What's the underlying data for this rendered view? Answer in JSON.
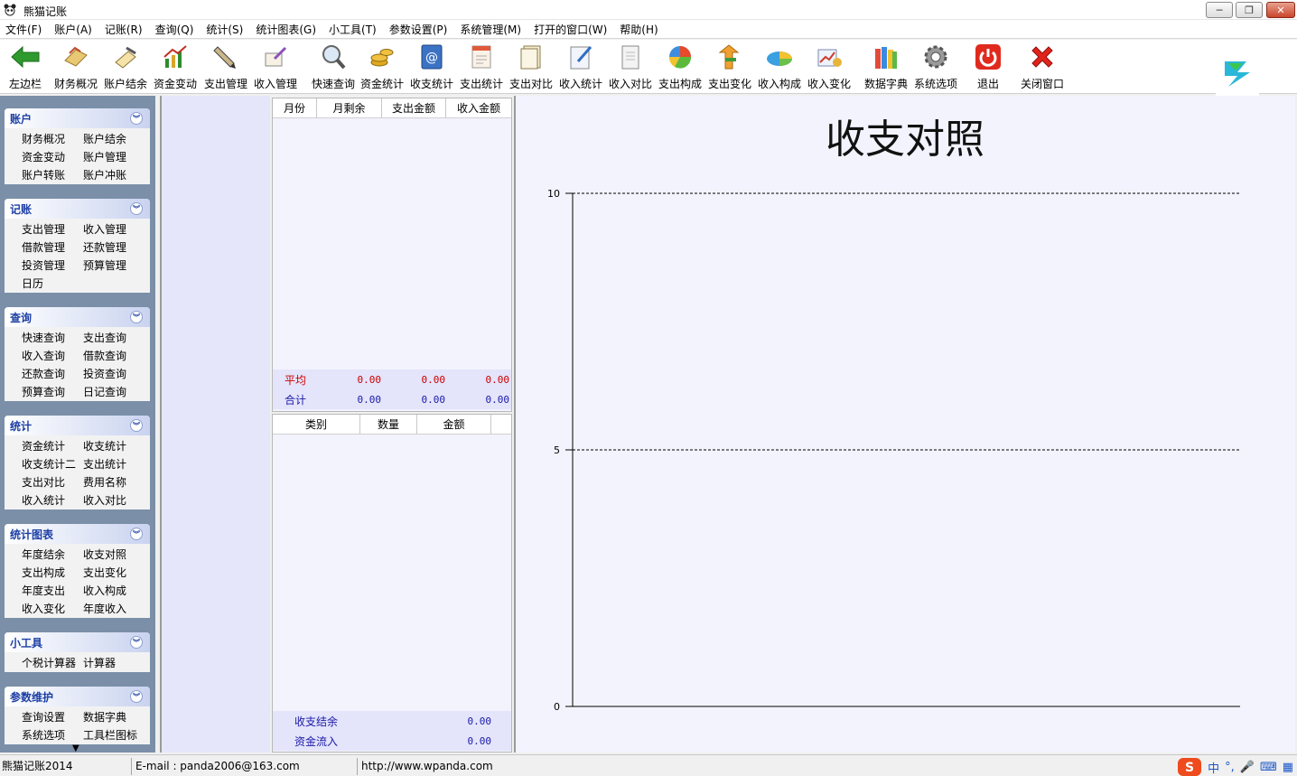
{
  "window": {
    "title": "熊猫记账",
    "buttons": {
      "minimize": "─",
      "restore": "❐",
      "close": "✕"
    }
  },
  "menu": [
    "文件(F)",
    "账户(A)",
    "记账(R)",
    "查询(Q)",
    "统计(S)",
    "统计图表(G)",
    "小工具(T)",
    "参数设置(P)",
    "系统管理(M)",
    "打开的窗口(W)",
    "帮助(H)"
  ],
  "toolbar": {
    "items": [
      {
        "label": "左边栏",
        "icon": "left-arrow-icon"
      },
      {
        "label": "财务概况",
        "icon": "finance-overview-icon"
      },
      {
        "label": "账户结余",
        "icon": "account-balance-icon"
      },
      {
        "label": "资金变动",
        "icon": "fund-change-icon"
      },
      {
        "label": "支出管理",
        "icon": "expense-pen-icon"
      },
      {
        "label": "收入管理",
        "icon": "income-pen-icon"
      },
      {
        "label": "快速查询",
        "icon": "magnifier-icon"
      },
      {
        "label": "资金统计",
        "icon": "coins-icon"
      },
      {
        "label": "收支统计",
        "icon": "at-book-icon"
      },
      {
        "label": "支出统计",
        "icon": "expense-doc-icon"
      },
      {
        "label": "支出对比",
        "icon": "expense-compare-icon"
      },
      {
        "label": "收入统计",
        "icon": "income-doc-icon"
      },
      {
        "label": "收入对比",
        "icon": "income-compare-icon"
      },
      {
        "label": "支出构成",
        "icon": "pie-chart-icon"
      },
      {
        "label": "支出变化",
        "icon": "expense-trend-icon"
      },
      {
        "label": "收入构成",
        "icon": "income-pie-icon"
      },
      {
        "label": "收入变化",
        "icon": "income-trend-icon"
      },
      {
        "label": "数据字典",
        "icon": "books-icon"
      },
      {
        "label": "系统选项",
        "icon": "gear-icon"
      },
      {
        "label": "退出",
        "icon": "power-icon"
      },
      {
        "label": "关闭窗口",
        "icon": "close-x-icon"
      }
    ]
  },
  "sidebar": {
    "panels": [
      {
        "title": "账户",
        "items": [
          "财务概况",
          "账户结余",
          "资金变动",
          "账户管理",
          "账户转账",
          "账户冲账"
        ]
      },
      {
        "title": "记账",
        "items": [
          "支出管理",
          "收入管理",
          "借款管理",
          "还款管理",
          "投资管理",
          "预算管理",
          "日历"
        ]
      },
      {
        "title": "查询",
        "items": [
          "快速查询",
          "支出查询",
          "收入查询",
          "借款查询",
          "还款查询",
          "投资查询",
          "预算查询",
          "日记查询"
        ]
      },
      {
        "title": "统计",
        "items": [
          "资金统计",
          "收支统计",
          "收支统计二",
          "支出统计",
          "支出对比",
          "费用名称",
          "收入统计",
          "收入对比"
        ]
      },
      {
        "title": "统计图表",
        "items": [
          "年度结余",
          "收支对照",
          "支出构成",
          "支出变化",
          "年度支出",
          "收入构成",
          "收入变化",
          "年度收入"
        ]
      },
      {
        "title": "小工具",
        "items": [
          "个税计算器",
          "计算器"
        ]
      },
      {
        "title": "参数维护",
        "items": [
          "查询设置",
          "数据字典",
          "系统选项",
          "工具栏图标"
        ]
      }
    ]
  },
  "monthly_table": {
    "columns": [
      "月份",
      "月剩余",
      "支出金额",
      "收入金额"
    ],
    "avg_label": "平均",
    "avg_values": [
      "0.00",
      "0.00",
      "0.00"
    ],
    "total_label": "合计",
    "total_values": [
      "0.00",
      "0.00",
      "0.00"
    ]
  },
  "category_table": {
    "columns": [
      "类别",
      "数量",
      "金额"
    ],
    "balance_label": "收支结余",
    "balance_value": "0.00",
    "inflow_label": "资金流入",
    "inflow_value": "0.00"
  },
  "chart_data": {
    "type": "bar",
    "title": "收支对照",
    "categories": [],
    "series": [],
    "ylim": [
      0,
      10
    ],
    "yticks": [
      "0",
      "5",
      "10"
    ],
    "grid": true
  },
  "statusbar": {
    "app": "熊猫记账2014",
    "email": "E-mail : panda2006@163.com",
    "url": "http://www.wpanda.com",
    "ime": [
      "中",
      "°,",
      "🎤",
      "⌨",
      "▦"
    ]
  },
  "colors": {
    "accent": "#1d3fa5",
    "red": "#cc0000",
    "blue": "#1a1aa8",
    "panel_bg": "#f3f3fe"
  }
}
